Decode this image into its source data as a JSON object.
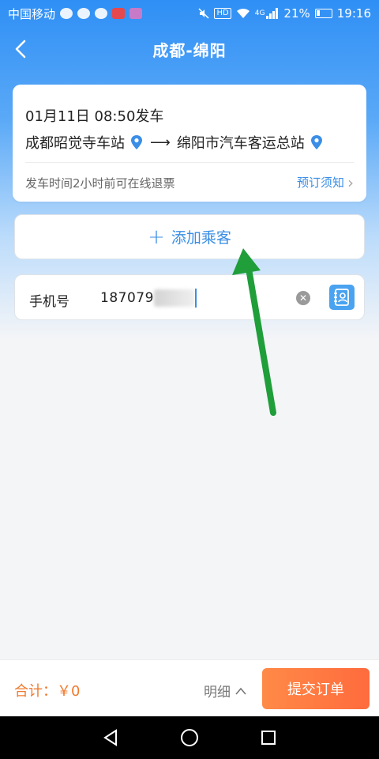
{
  "status_bar": {
    "carrier": "中国移动",
    "battery_percent": "21%",
    "time": "19:16",
    "network": "4G",
    "hd": "HD"
  },
  "nav": {
    "title": "成都-绵阳",
    "back_icon": "chevron-left-icon"
  },
  "trip": {
    "departure": "01月11日  08:50发车",
    "from_station": "成都昭觉寺车站",
    "arrow": "⟶",
    "to_station": "绵阳市汽车客运总站",
    "refund_note": "发车时间2小时前可在线退票",
    "booking_notice": "预订须知",
    "notice_chevron": "›"
  },
  "add_passenger": {
    "plus": "+",
    "label": "添加乘客"
  },
  "phone": {
    "label": "手机号",
    "value": "187079"
  },
  "bottom": {
    "total_label": "合计：￥0",
    "detail_label": "明细",
    "detail_chevron": "^",
    "submit_label": "提交订单"
  },
  "colors": {
    "accent": "#3a8ee6",
    "primary_gradient_top": "#2f8ff5",
    "price": "#f07a2e",
    "submit": "#ff6b3d",
    "annotation_arrow": "#1f9e3a"
  }
}
